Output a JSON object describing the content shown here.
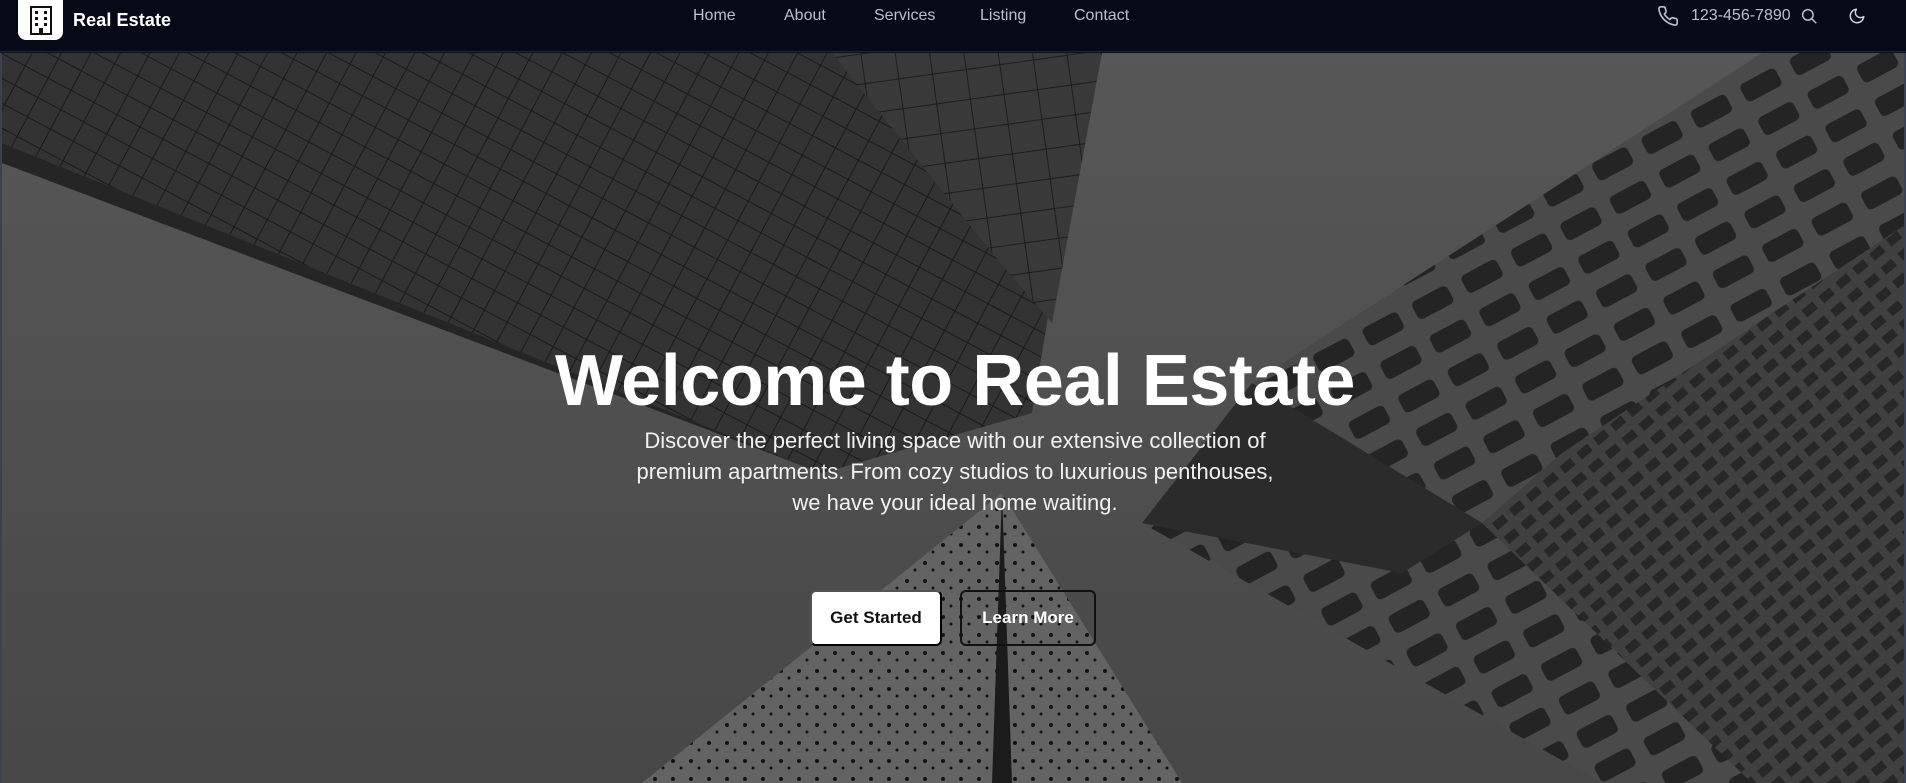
{
  "brand": {
    "name": "Real Estate",
    "logo_icon": "building-icon"
  },
  "nav": {
    "items": [
      {
        "label": "Home"
      },
      {
        "label": "About"
      },
      {
        "label": "Services"
      },
      {
        "label": "Listing"
      },
      {
        "label": "Contact"
      }
    ]
  },
  "header_right": {
    "phone": "123-456-7890",
    "phone_icon": "phone-icon",
    "search_icon": "search-icon",
    "theme_icon": "moon-icon"
  },
  "hero": {
    "title": "Welcome to Real Estate",
    "description": "Discover the perfect living space with our extensive collection of premium apartments. From cozy studios to luxurious penthouses, we have your ideal home waiting.",
    "primary_button": "Get Started",
    "secondary_button": "Learn More"
  },
  "colors": {
    "navbar_bg": "#050a16",
    "nav_text": "#b9c0cc",
    "hero_text": "#ffffff",
    "primary_button_bg": "#ffffff"
  }
}
